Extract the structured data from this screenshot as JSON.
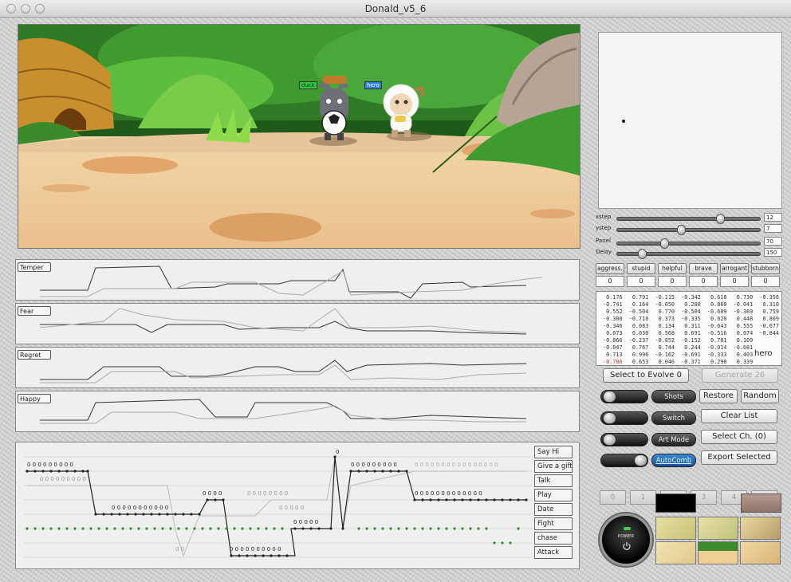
{
  "window": {
    "title": "Donald_v5_6"
  },
  "scene": {
    "labels": [
      {
        "text": "duck",
        "color": "#2ecc40"
      },
      {
        "text": "hero",
        "color": "#2f7fe0"
      }
    ]
  },
  "graphs": [
    {
      "label": "Temper"
    },
    {
      "label": "Fear"
    },
    {
      "label": "Regret"
    },
    {
      "label": "Happy"
    }
  ],
  "actions": {
    "buttons": [
      "Say Hi",
      "Give a gift",
      "Talk",
      "Play",
      "Date",
      "Fight",
      "chase",
      "Attack"
    ],
    "dot_labels": {
      "row1_left": "0 0 0 0 0 0 0 0 0",
      "row2_left": "0 0 0 0 0 0 0 0 0",
      "row3_mid": "0 0 0 0",
      "row3_mid2": "0 0 0 0 0 0 0 0",
      "row4_left": "0 0 0 0 0 0 0 0 0 0 0",
      "row4_mid": "0 0 0 0 0",
      "row5_mid": "0 0 0 0 0",
      "row5_right": "0 0 0 0 0 0 0 0 0 0 0 0 0",
      "row1_right": "0 0 0 0 0 0 0 0 0",
      "row1_right2": "0 0 0 0 0 0 0 0 0 0 0 0 0 0 0 0",
      "row8_mid": "0 0 0 0 0 0 0 0 0 0",
      "row_low": "0 0",
      "peak": "0"
    }
  },
  "sliders": [
    {
      "label": "xstep",
      "value": "12",
      "pos": 0.73
    },
    {
      "label": "ystep",
      "value": "7",
      "pos": 0.44
    },
    {
      "label": "Panel",
      "value": "70",
      "pos": 0.32
    },
    {
      "label": "Delay",
      "value": "150",
      "pos": 0.15
    }
  ],
  "traits": [
    {
      "label": "aggress.",
      "value": "0"
    },
    {
      "label": "stupid",
      "value": "0"
    },
    {
      "label": "helpful",
      "value": "0"
    },
    {
      "label": "brave",
      "value": "0"
    },
    {
      "label": "arrogant",
      "value": "0"
    },
    {
      "label": "stubborn",
      "value": "0"
    }
  ],
  "matrix": {
    "rows": [
      " 0.176   0.791  -0.115  -0.342   0.610   0.730  -0.356",
      "-0.741   0.164  -0.050   0.280   0.860  -0.041   0.310",
      " 0.552  -0.504   0.770  -0.504  -0.609  -0.369   0.759",
      "-0.300  -0.710   0.373  -0.335   0.020   0.448   0.809",
      "-0.346   0.083   0.134   0.311  -0.643   0.555  -0.677",
      " 0.073   0.030   0.568   0.691  -0.516   0.074  -0.844",
      "-0.866  -0.237  -0.852  -0.152   0.781   0.109",
      "-0.047   0.767   0.744   0.244  -0.014  -0.681",
      " 0.713   0.996  -0.162  -0.691  -0.333   0.403",
      "-0.786   0.653   0.046  -0.371   0.290   0.339"
    ],
    "highlight_value": "-0.786",
    "name": "hero"
  },
  "controls": {
    "select_evolve": "Select to Evolve 0",
    "generate": "Generate 26",
    "restore": "Restore",
    "random": "Random",
    "clear_list": "Clear List",
    "select_ch": "Select Ch. (0)",
    "export_selected": "Export Selected"
  },
  "toggles": [
    {
      "label": "Shots",
      "on": false
    },
    {
      "label": "Switch",
      "on": false
    },
    {
      "label": "Art Mode",
      "on": false
    },
    {
      "label": "AutoComb",
      "on": true
    }
  ],
  "number_buttons": [
    "0",
    "1",
    "2",
    "3",
    "4",
    "5"
  ],
  "power": {
    "label": "POWER"
  }
}
